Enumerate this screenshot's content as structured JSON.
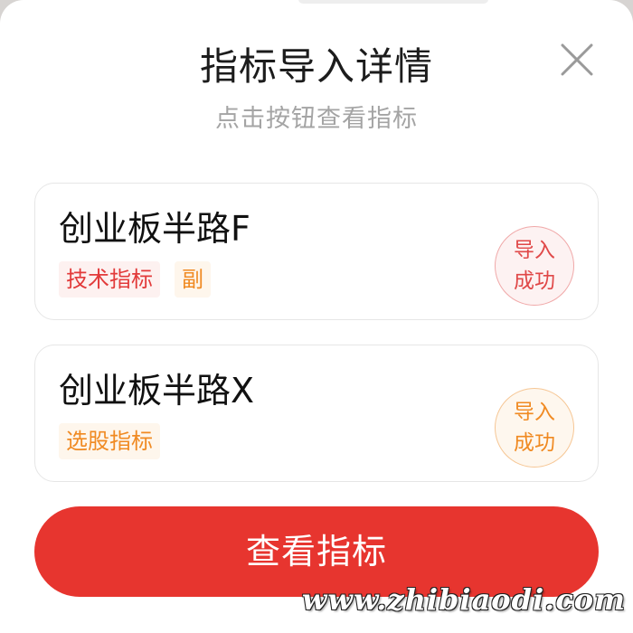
{
  "dialog": {
    "title": "指标导入详情",
    "subtitle": "点击按钮查看指标",
    "close_icon": "close-icon"
  },
  "indicators": [
    {
      "name": "创业板半路F",
      "tags": [
        "技术指标",
        "副"
      ],
      "status_line1": "导入",
      "status_line2": "成功",
      "status_color": "#e04848"
    },
    {
      "name": "创业板半路X",
      "tags": [
        "选股指标"
      ],
      "status_line1": "导入",
      "status_line2": "成功",
      "status_color": "#f08a22"
    }
  ],
  "actions": {
    "view_button_label": "查看指标"
  },
  "watermark": {
    "text": "www.zhibiaodi.com"
  },
  "colors": {
    "primary": "#e7352f",
    "tag_red": "#e23a3a",
    "tag_orange": "#f08a22"
  }
}
